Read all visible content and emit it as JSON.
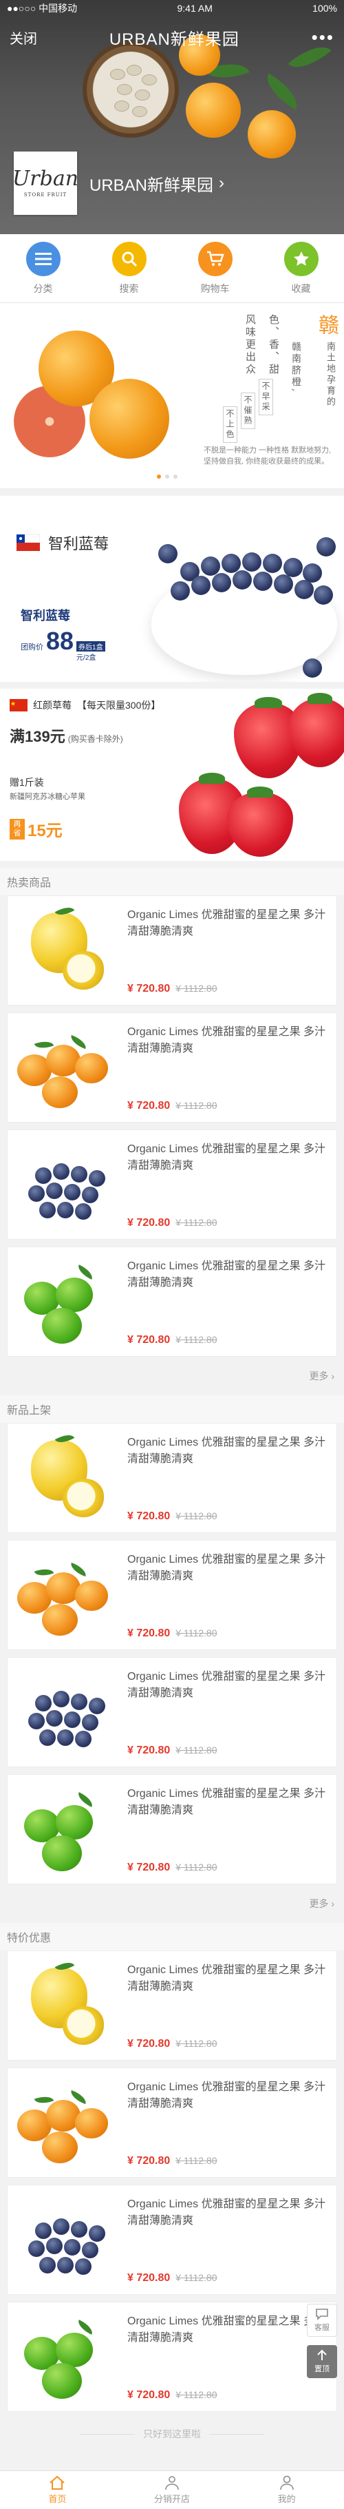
{
  "status_bar": {
    "carrier": "●●○○○ 中国移动",
    "time": "9:41 AM",
    "battery": "100%"
  },
  "nav": {
    "close_label": "关闭",
    "title": "URBAN新鲜果园",
    "more_label": "•••"
  },
  "brand": {
    "logo_main": "Urban",
    "logo_sub": "STORE FRUIT",
    "name": "URBAN新鲜果园",
    "arrow": "›"
  },
  "categories": [
    {
      "label": "分类",
      "icon": "list-icon",
      "color": "#4a90e2"
    },
    {
      "label": "搜索",
      "icon": "search-icon",
      "color": "#f5b800"
    },
    {
      "label": "购物车",
      "icon": "cart-icon",
      "color": "#f7921e"
    },
    {
      "label": "收藏",
      "icon": "star-icon",
      "color": "#7cc22a"
    }
  ],
  "banner1": {
    "big_char": "赣",
    "col1": "南土地孕育的",
    "col2": "赣南脐橙,",
    "col3": "色、香、甜",
    "col4": "风味更出众",
    "col5": "不早采",
    "col6": "不催熟",
    "col7": "不上色",
    "desc": "不脱是一种能力 一种性格 默默地努力, 坚持做自我, 你终能收获最终的成果。"
  },
  "banner2": {
    "flag": "chile-flag",
    "title": "智利蓝莓",
    "name": "智利蓝莓",
    "price_label": "团购价",
    "price": "88",
    "price_unit": "元/2盒",
    "price_tag": "券后1盒"
  },
  "banner3": {
    "flag": "china-flag",
    "name": "红颜草莓",
    "limit": "【每天限量300份】",
    "deal": "满139元",
    "deal_note": "(购买香卡除外)",
    "gift": "赠1斤装",
    "gift_note": "新疆阿克苏冰糖心苹果",
    "save_label": "再省",
    "save": "15元"
  },
  "sections": [
    {
      "title": "热卖商品",
      "more": "更多 ›",
      "items": [
        {
          "fruit": "apple",
          "name": "Organic Limes 优雅甜蜜的星星之果 多汁清甜薄脆清爽",
          "price": "¥ 720.80",
          "old_price": "¥ 1112.80"
        },
        {
          "fruit": "tangerine",
          "name": "Organic Limes 优雅甜蜜的星星之果 多汁清甜薄脆清爽",
          "price": "¥ 720.80",
          "old_price": "¥ 1112.80"
        },
        {
          "fruit": "blueberry",
          "name": "Organic Limes 优雅甜蜜的星星之果 多汁清甜薄脆清爽",
          "price": "¥ 720.80",
          "old_price": "¥ 1112.80"
        },
        {
          "fruit": "lime",
          "name": "Organic Limes 优雅甜蜜的星星之果 多汁清甜薄脆清爽",
          "price": "¥ 720.80",
          "old_price": "¥ 1112.80"
        }
      ]
    },
    {
      "title": "新品上架",
      "more": "更多 ›",
      "items": [
        {
          "fruit": "apple",
          "name": "Organic Limes 优雅甜蜜的星星之果 多汁清甜薄脆清爽",
          "price": "¥ 720.80",
          "old_price": "¥ 1112.80"
        },
        {
          "fruit": "tangerine",
          "name": "Organic Limes 优雅甜蜜的星星之果 多汁清甜薄脆清爽",
          "price": "¥ 720.80",
          "old_price": "¥ 1112.80"
        },
        {
          "fruit": "blueberry",
          "name": "Organic Limes 优雅甜蜜的星星之果 多汁清甜薄脆清爽",
          "price": "¥ 720.80",
          "old_price": "¥ 1112.80"
        },
        {
          "fruit": "lime",
          "name": "Organic Limes 优雅甜蜜的星星之果 多汁清甜薄脆清爽",
          "price": "¥ 720.80",
          "old_price": "¥ 1112.80"
        }
      ]
    },
    {
      "title": "特价优惠",
      "more": "",
      "items": [
        {
          "fruit": "apple",
          "name": "Organic Limes 优雅甜蜜的星星之果 多汁清甜薄脆清爽",
          "price": "¥ 720.80",
          "old_price": "¥ 1112.80"
        },
        {
          "fruit": "tangerine",
          "name": "Organic Limes 优雅甜蜜的星星之果 多汁清甜薄脆清爽",
          "price": "¥ 720.80",
          "old_price": "¥ 1112.80"
        },
        {
          "fruit": "blueberry",
          "name": "Organic Limes 优雅甜蜜的星星之果 多汁清甜薄脆清爽",
          "price": "¥ 720.80",
          "old_price": "¥ 1112.80"
        },
        {
          "fruit": "lime",
          "name": "Organic Limes 优雅甜蜜的星星之果 多汁清甜薄脆清爽",
          "price": "¥ 720.80",
          "old_price": "¥ 1112.80"
        }
      ]
    }
  ],
  "end_text": "只好到这里啦",
  "float_buttons": {
    "service": "客服",
    "top": "置顶"
  },
  "tabs": [
    {
      "label": "首页",
      "icon": "home-icon",
      "active": true
    },
    {
      "label": "分销开店",
      "icon": "user-group-icon",
      "active": false
    },
    {
      "label": "我的",
      "icon": "user-icon",
      "active": false
    }
  ],
  "colors": {
    "accent": "#f7921e",
    "price": "#e4392b"
  }
}
